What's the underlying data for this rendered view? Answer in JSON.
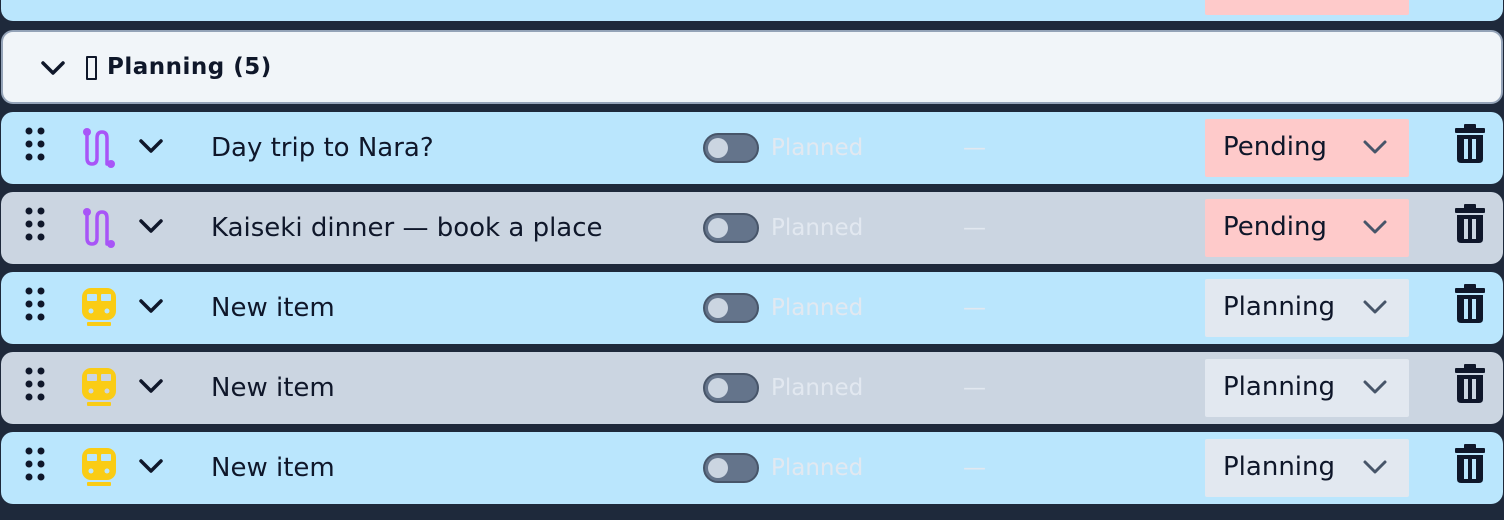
{
  "colors": {
    "background": "#1e293b",
    "row_blue": "#bae6fd",
    "row_gray": "#cbd5e1",
    "header_bg": "#f1f5f9",
    "pending_bg": "#fecaca",
    "planning_bg": "#e2e8f0",
    "route_icon": "#a855f7",
    "train_icon": "#facc15"
  },
  "group": {
    "title": "Planning (5)",
    "icon": "missing-glyph-icon"
  },
  "items": [
    {
      "title": "Day trip to Nara?",
      "type_icon": "route-icon",
      "toggle_label": "Planned",
      "time": "—",
      "status": "Pending"
    },
    {
      "title": "Kaiseki dinner — book a place",
      "type_icon": "route-icon",
      "toggle_label": "Planned",
      "time": "—",
      "status": "Pending"
    },
    {
      "title": "New item",
      "type_icon": "train-icon",
      "toggle_label": "Planned",
      "time": "—",
      "status": "Planning"
    },
    {
      "title": "New item",
      "type_icon": "train-icon",
      "toggle_label": "Planned",
      "time": "—",
      "status": "Planning"
    },
    {
      "title": "New item",
      "type_icon": "train-icon",
      "toggle_label": "Planned",
      "time": "—",
      "status": "Planning"
    }
  ]
}
